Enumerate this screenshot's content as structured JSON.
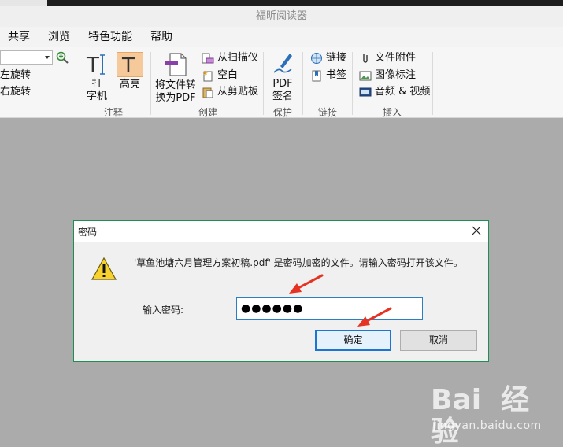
{
  "window": {
    "title": "福昕阅读器"
  },
  "menubar": {
    "items": [
      "共享",
      "浏览",
      "特色功能",
      "帮助"
    ]
  },
  "ribbon": {
    "rotate_left": "左旋转",
    "rotate_right": "右旋转",
    "typewriter_label_1": "打",
    "typewriter_label_2": "字机",
    "highlight_label": "高亮",
    "convert_label_1": "将文件转",
    "convert_label_2": "换为PDF",
    "from_scanner": "从扫描仪",
    "blank": "空白",
    "from_clipboard": "从剪贴板",
    "pdf_sign_1": "PDF",
    "pdf_sign_2": "签名",
    "link": "链接",
    "bookmark": "书签",
    "file_attachment": "文件附件",
    "image_annotation": "图像标注",
    "audio_video": "音频 & 视频",
    "groups": {
      "annotate": "注释",
      "create": "创建",
      "protect": "保护",
      "links": "链接",
      "insert": "插入"
    }
  },
  "dialog": {
    "title": "密码",
    "message": "'草鱼池塘六月管理方案初稿.pdf' 是密码加密的文件。请输入密码打开该文件。",
    "password_label": "输入密码:",
    "password_value": "●●●●●●",
    "ok_label": "确定",
    "cancel_label": "取消"
  },
  "watermark": {
    "logo": "Bai  经验",
    "url": "jingyan.baidu.com"
  },
  "colors": {
    "accent_arrow": "#e53222",
    "dialog_border": "#1d8f54",
    "ok_border": "#1a76d2",
    "highlight_active": "#f6c99a"
  },
  "icons": [
    "zoom-in-icon",
    "typewriter-icon",
    "highlight-icon",
    "convert-to-pdf-icon",
    "scanner-icon",
    "blank-page-icon",
    "clipboard-icon",
    "pdf-sign-icon",
    "link-icon",
    "bookmark-icon",
    "file-attachment-icon",
    "image-annotation-icon",
    "audio-video-icon",
    "close-icon",
    "warning-icon"
  ]
}
